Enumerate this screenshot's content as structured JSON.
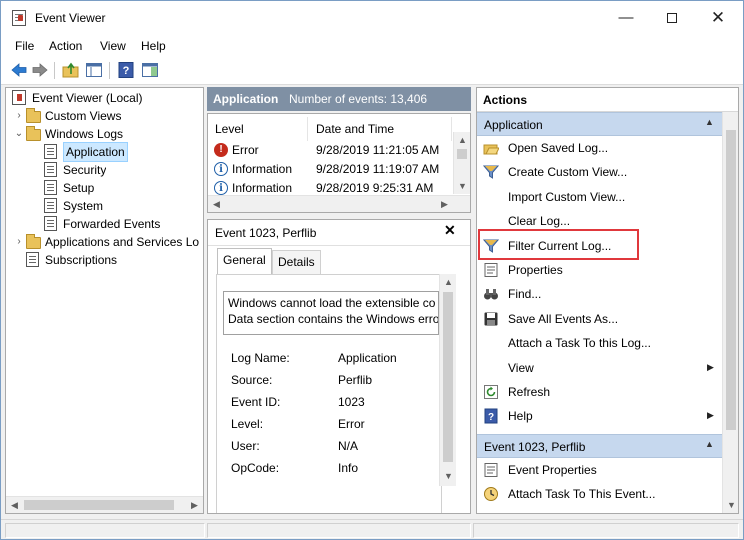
{
  "window": {
    "title": "Event Viewer",
    "minimize_glyph": "—",
    "close_glyph": "✕"
  },
  "menu": {
    "items": [
      "File",
      "Action",
      "View",
      "Help"
    ]
  },
  "tree": {
    "root": "Event Viewer (Local)",
    "items": [
      {
        "label": "Custom Views",
        "level": 1,
        "toggle": "›",
        "icon": "folder-icon"
      },
      {
        "label": "Windows Logs",
        "level": 1,
        "toggle": "⌄",
        "icon": "folder-icon"
      },
      {
        "label": "Application",
        "level": 2,
        "toggle": "",
        "icon": "log-icon",
        "selected": true
      },
      {
        "label": "Security",
        "level": 2,
        "toggle": "",
        "icon": "log-icon"
      },
      {
        "label": "Setup",
        "level": 2,
        "toggle": "",
        "icon": "log-icon"
      },
      {
        "label": "System",
        "level": 2,
        "toggle": "",
        "icon": "log-icon"
      },
      {
        "label": "Forwarded Events",
        "level": 2,
        "toggle": "",
        "icon": "log-icon"
      },
      {
        "label": "Applications and Services Lo",
        "level": 1,
        "toggle": "›",
        "icon": "folder-icon"
      },
      {
        "label": "Subscriptions",
        "level": 1,
        "toggle": "",
        "icon": "log-icon"
      }
    ]
  },
  "events": {
    "header_title": "Application",
    "count_label": "Number of events: 13,406",
    "columns": [
      "Level",
      "Date and Time"
    ],
    "rows": [
      {
        "level": "Error",
        "icon": "error-icon",
        "date": "9/28/2019 11:21:05 AM"
      },
      {
        "level": "Information",
        "icon": "info-icon",
        "date": "9/28/2019 11:19:07 AM"
      },
      {
        "level": "Information",
        "icon": "info-icon",
        "date": "9/28/2019 9:25:31 AM"
      }
    ]
  },
  "detail": {
    "title": "Event 1023, Perflib",
    "close_glyph": "✕",
    "tabs": [
      "General",
      "Details"
    ],
    "message_line1": "Windows cannot load the extensible co",
    "message_line2": "Data section contains the Windows erro",
    "props": [
      {
        "label": "Log Name:",
        "value": "Application"
      },
      {
        "label": "Source:",
        "value": "Perflib"
      },
      {
        "label": "Event ID:",
        "value": "1023"
      },
      {
        "label": "Level:",
        "value": "Error"
      },
      {
        "label": "User:",
        "value": "N/A"
      },
      {
        "label": "OpCode:",
        "value": "Info"
      }
    ]
  },
  "actions": {
    "header": "Actions",
    "section1_title": "Application",
    "section1_items": [
      {
        "label": "Open Saved Log...",
        "icon": "open-folder-icon",
        "submenu": false
      },
      {
        "label": "Create Custom View...",
        "icon": "filter-icon",
        "submenu": false
      },
      {
        "label": "Import Custom View...",
        "icon": "",
        "submenu": false
      },
      {
        "label": "Clear Log...",
        "icon": "",
        "submenu": false
      },
      {
        "label": "Filter Current Log...",
        "icon": "filter-icon",
        "submenu": false
      },
      {
        "label": "Properties",
        "icon": "properties-icon",
        "submenu": false
      },
      {
        "label": "Find...",
        "icon": "binoculars-icon",
        "submenu": false
      },
      {
        "label": "Save All Events As...",
        "icon": "save-icon",
        "submenu": false
      },
      {
        "label": "Attach a Task To this Log...",
        "icon": "",
        "submenu": false
      },
      {
        "label": "View",
        "icon": "",
        "submenu": true
      },
      {
        "label": "Refresh",
        "icon": "refresh-icon",
        "submenu": false
      },
      {
        "label": "Help",
        "icon": "help-icon",
        "submenu": true
      }
    ],
    "section2_title": "Event 1023, Perflib",
    "section2_items": [
      {
        "label": "Event Properties",
        "icon": "properties-icon",
        "submenu": false
      },
      {
        "label": "Attach Task To This Event...",
        "icon": "task-icon",
        "submenu": false
      }
    ]
  },
  "colors": {
    "mid_header_bg": "#7f90a4",
    "section_bg": "#c6d8ee",
    "highlight": "#e0383c",
    "selection": "#cce8ff"
  }
}
